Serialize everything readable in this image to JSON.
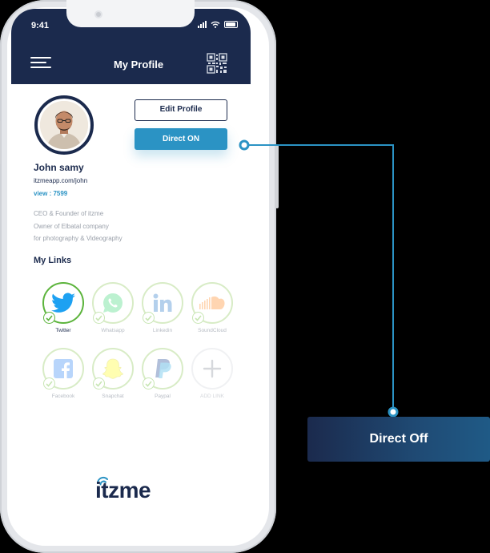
{
  "status": {
    "time": "9:41"
  },
  "header": {
    "title": "My Profile",
    "menu_icon": "menu-icon",
    "qr_icon": "qr-code-icon"
  },
  "profile": {
    "name": "John samy",
    "url": "itzmeapp.com/john",
    "views": "view : 7599",
    "bio": [
      "CEO & Founder of itzme",
      "Owner of Elbatal company",
      "for photography & Videography"
    ]
  },
  "buttons": {
    "edit_profile": "Edit Profile",
    "direct_on": "Direct ON"
  },
  "links_title": "My Links",
  "links": [
    {
      "label": "Twitter",
      "icon": "twitter-icon",
      "active": true
    },
    {
      "label": "Whatsapp",
      "icon": "whatsapp-icon",
      "active": false
    },
    {
      "label": "Linkedin",
      "icon": "linkedin-icon",
      "active": false
    },
    {
      "label": "SoundCloud",
      "icon": "soundcloud-icon",
      "active": false
    },
    {
      "label": "Facebook",
      "icon": "facebook-icon",
      "active": false
    },
    {
      "label": "Snapchat",
      "icon": "snapchat-icon",
      "active": false
    },
    {
      "label": "Paypal",
      "icon": "paypal-icon",
      "active": false
    },
    {
      "label": "ADD LINK",
      "icon": "plus-icon",
      "active": false
    }
  ],
  "brand": {
    "logo_text": "itzme"
  },
  "callout": {
    "label": "Direct Off"
  },
  "colors": {
    "navy": "#1b2a4d",
    "accent": "#2b93c4",
    "active_green": "#5cb43c"
  }
}
